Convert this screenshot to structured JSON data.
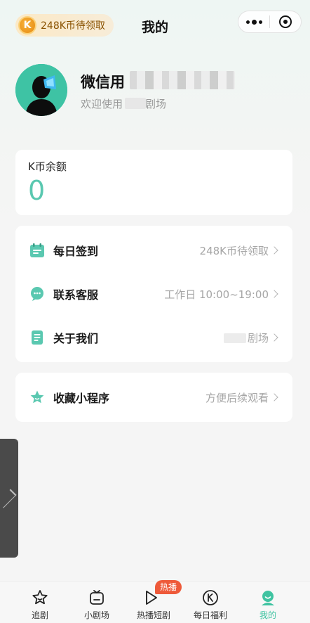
{
  "header": {
    "coin_badge": "K",
    "coin_pill": "248K币待领取",
    "title": "我的"
  },
  "capsule": {
    "more_icon": "more-dots-icon",
    "close_icon": "target-circle-icon"
  },
  "profile": {
    "name_prefix": "微信用",
    "subtitle_prefix": "欢迎使用",
    "subtitle_suffix": "剧场"
  },
  "balance": {
    "label": "K币余额",
    "value": "0"
  },
  "menu": [
    {
      "label": "每日签到",
      "value": "248K币待领取",
      "icon": "calendar-icon"
    },
    {
      "label": "联系客服",
      "value": "工作日 10:00~19:00",
      "icon": "chat-icon"
    },
    {
      "label": "关于我们",
      "value": "剧场",
      "icon": "document-icon"
    }
  ],
  "favorite": {
    "label": "收藏小程序",
    "value": "方便后续观看",
    "icon": "star-icon"
  },
  "tabs": [
    {
      "label": "追剧",
      "icon": "star-outline-icon"
    },
    {
      "label": "小剧场",
      "icon": "tv-icon"
    },
    {
      "label": "热播短剧",
      "icon": "play-icon",
      "badge": "热播"
    },
    {
      "label": "每日福利",
      "icon": "k-coin-icon"
    },
    {
      "label": "我的",
      "icon": "user-icon",
      "active": true
    }
  ],
  "colors": {
    "accent": "#3fc3a1",
    "balance": "#5ac8b0",
    "hot_badge": "#ee5a3a",
    "coin": "#e68a12"
  }
}
